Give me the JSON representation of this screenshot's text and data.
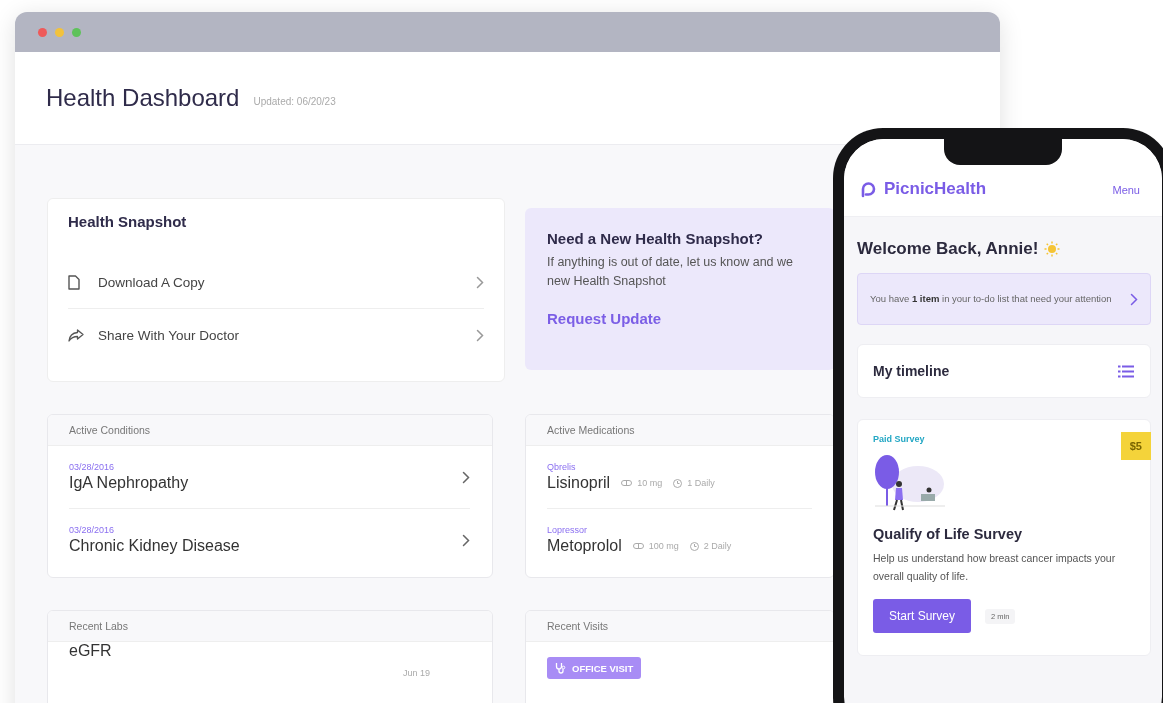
{
  "browser": {
    "title": "Health Dashboard",
    "updated": "Updated: 06/20/23"
  },
  "snapshot": {
    "title": "Health Snapshot",
    "actions": [
      {
        "label": "Download A Copy",
        "kind": "download"
      },
      {
        "label": "Share With Your Doctor",
        "kind": "share"
      }
    ]
  },
  "request": {
    "title": "Need a New Health Snapshot?",
    "body_lines": [
      "If anything is out of date, let us know and we",
      "new Health Snapshot"
    ],
    "link": "Request Update"
  },
  "conditions": {
    "title": "Active Conditions",
    "items": [
      {
        "date": "03/28/2016",
        "name": "IgA Nephropathy"
      },
      {
        "date": "03/28/2016",
        "name": "Chronic Kidney Disease"
      }
    ]
  },
  "medications": {
    "title": "Active Medications",
    "items": [
      {
        "brand": "Qbrelis",
        "name": "Lisinopril",
        "dose": "10 mg",
        "frequency": "1 Daily"
      },
      {
        "brand": "Lopressor",
        "name": "Metoprolol",
        "dose": "100 mg",
        "frequency": "2 Daily"
      }
    ]
  },
  "labs": {
    "title": "Recent Labs",
    "items": [
      {
        "name": "eGFR",
        "date": "Jun 19"
      }
    ]
  },
  "visits": {
    "title": "Recent Visits",
    "items": [
      {
        "type": "OFFICE VISIT"
      }
    ]
  },
  "phone": {
    "brand": "PicnicHealth",
    "menu": "Menu",
    "greeting": "Welcome Back, Annie!",
    "todo": "You have **1 item** in your to-do list that need your attention",
    "timeline": "My timeline",
    "survey": {
      "tag": "Paid Survey",
      "reward": "$5",
      "title": "Qualify of Life Survey",
      "description": "Help us understand how breast cancer impacts your overall quality of life.",
      "button": "Start Survey",
      "duration": "2 min"
    }
  }
}
